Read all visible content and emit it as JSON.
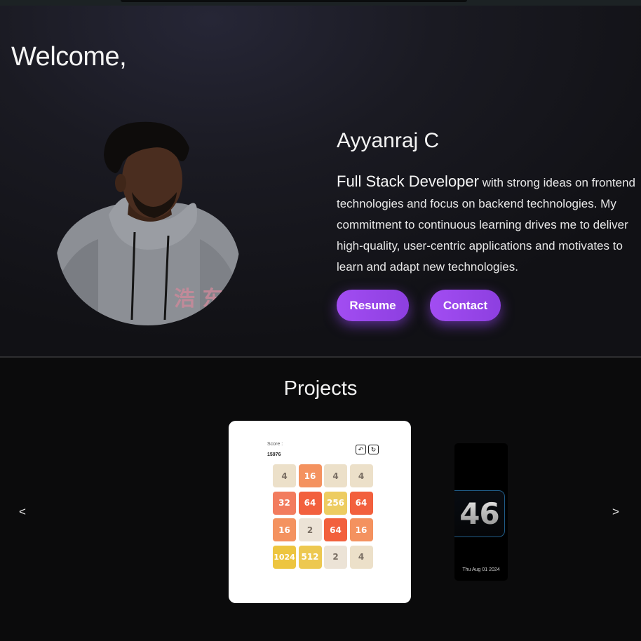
{
  "hero": {
    "greeting": "Welcome,",
    "name": "Ayyanraj C",
    "role": "Full Stack Developer",
    "bio": " with strong ideas on frontend technologies and focus on backend technologies. My commitment to continuous learning drives me to deliver high-quality, user-centric applications and motivates to learn and adapt new technologies.",
    "resume_label": "Resume",
    "contact_label": "Contact",
    "accent_color": "#9b47ef"
  },
  "projects": {
    "title": "Projects",
    "prev_label": "<",
    "next_label": ">",
    "game_2048": {
      "score_label": "Score :",
      "score_value": "15976",
      "undo_icon": "undo-icon",
      "restart_icon": "restart-icon",
      "tiles": [
        [
          "4",
          "16",
          "4",
          "4"
        ],
        [
          "32",
          "64",
          "256",
          "64"
        ],
        [
          "16",
          "2",
          "64",
          "16"
        ],
        [
          "1024",
          "512",
          "2",
          "4"
        ]
      ]
    },
    "clock": {
      "value": "46",
      "date": "Thu Aug 01 2024"
    }
  }
}
